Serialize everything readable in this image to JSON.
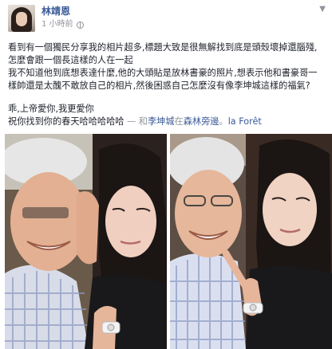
{
  "post": {
    "author": "林靖恩",
    "time": "1 小時前",
    "privacy_icon": "globe-icon",
    "menu_icon": "chevron-down-icon",
    "lines": [
      "看到有一個獨民分享我的相片超多,標題大致是很無解找到底是頭殼壞掉還腦殘,",
      "怎麼會跟一個長這樣的人在一起",
      "我不知道他到底想表達什麼,他的大頭貼是放林書豪的照片,想表示他和書豪哥一",
      "樣帥還是太醜不敢放自己的相片,然後困惑自己怎麼沒有像李坤城這樣的福氣?"
    ],
    "line_blessing": "乖,上帝愛你,我更愛你",
    "line_wish": "祝你找到你的春天哈哈哈哈哈",
    "separator": " — 和",
    "tagged_person": "李坤城",
    "at_word": "在",
    "location_1": "森林旁邊",
    "location_sep": "。",
    "location_2": "la Forêt"
  },
  "photos": [
    {
      "name": "photo-1"
    },
    {
      "name": "photo-2"
    }
  ]
}
